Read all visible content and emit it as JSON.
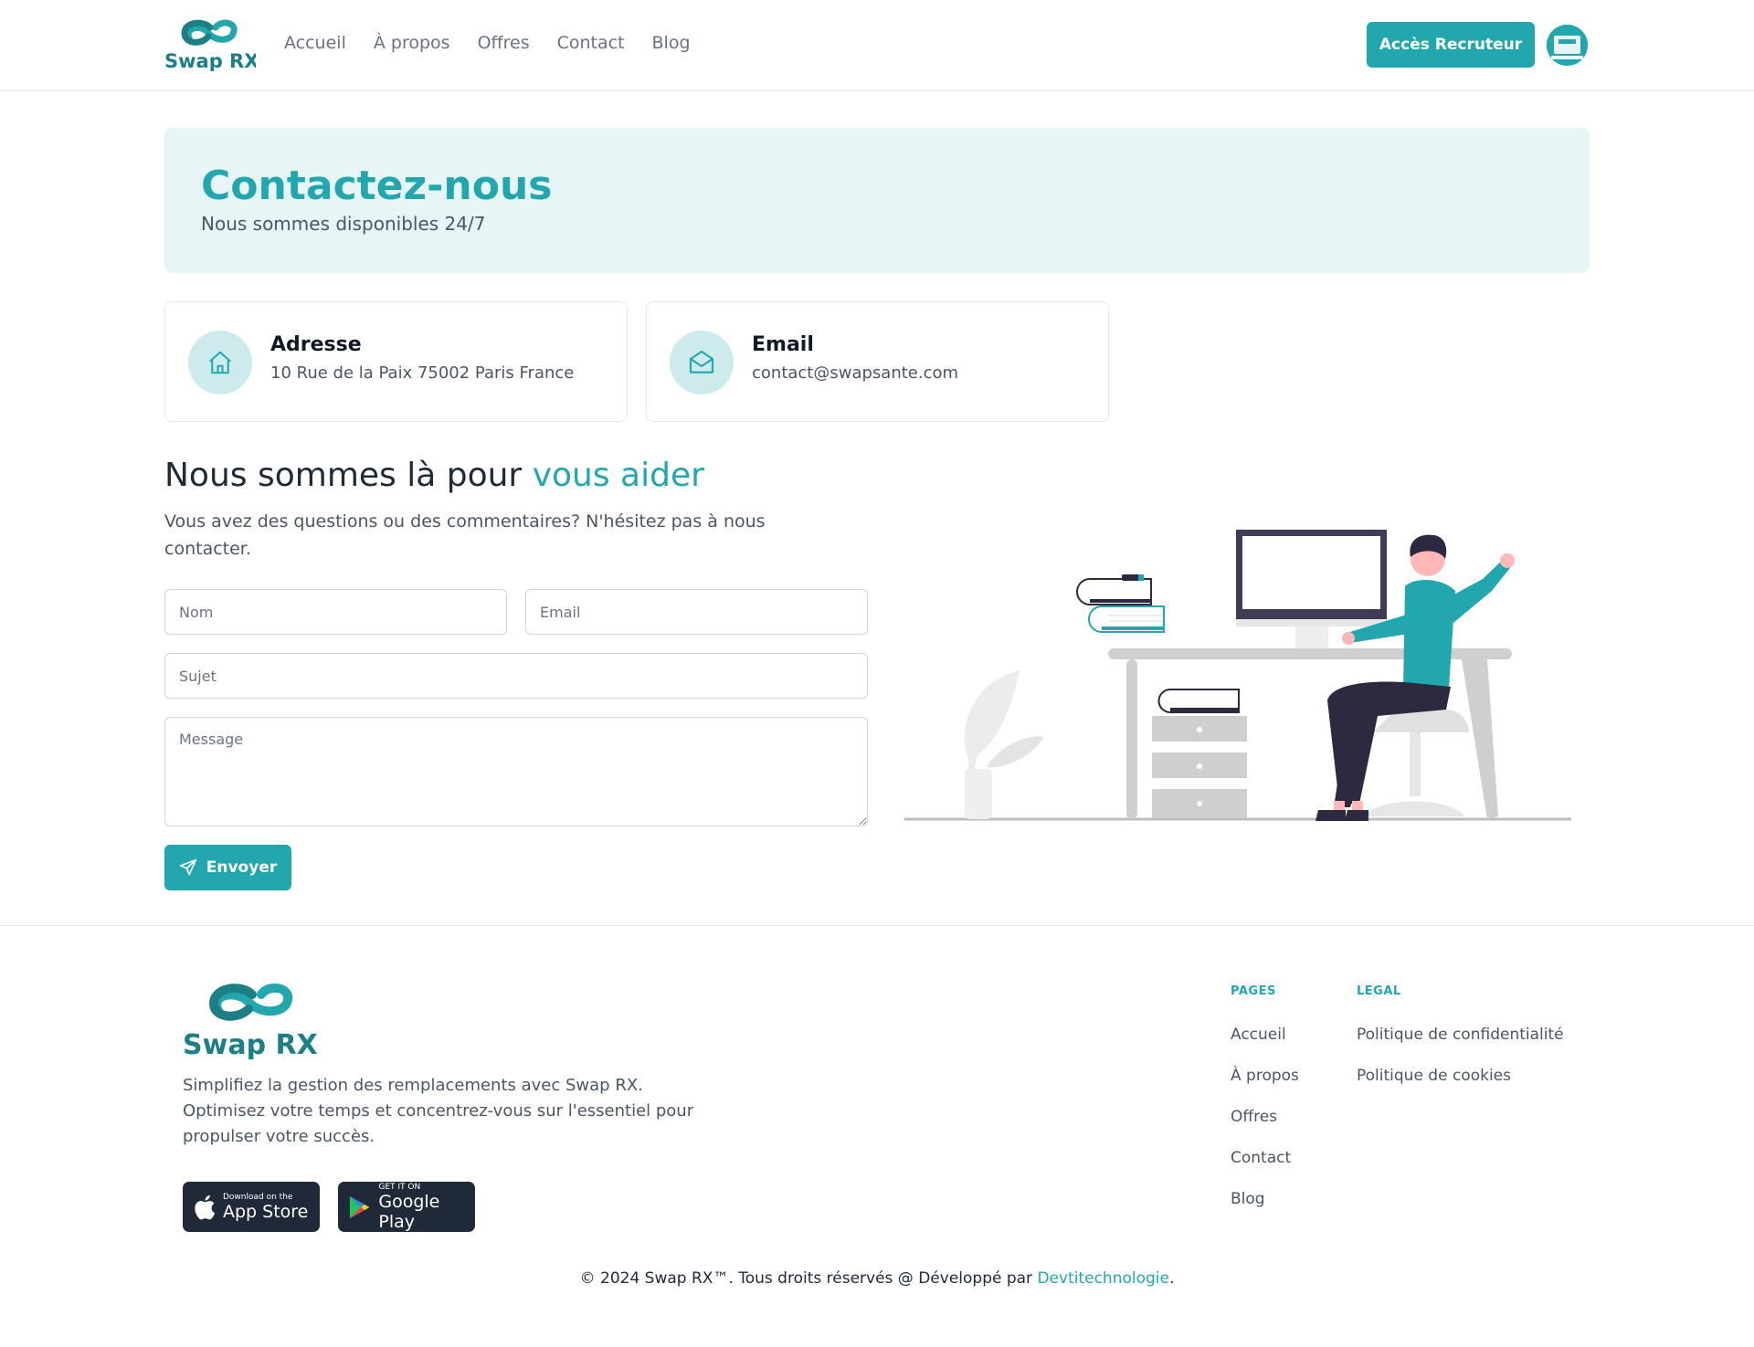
{
  "brand": {
    "name": "Swap RX",
    "accent_color": "#22a7ae",
    "dark_color": "#2c2a3e"
  },
  "nav": {
    "links": [
      "Accueil",
      "À propos",
      "Offres",
      "Contact",
      "Blog"
    ],
    "recruiter_button": "Accès Recruteur",
    "avatar_icon": "user-avatar-icon"
  },
  "hero": {
    "title": "Contactez-nous",
    "subtitle": "Nous sommes disponibles 24/7"
  },
  "info_cards": [
    {
      "icon": "home-icon",
      "title": "Adresse",
      "value": "10 Rue de la Paix 75002 Paris France"
    },
    {
      "icon": "mail-icon",
      "title": "Email",
      "value": "contact@swapsante.com"
    }
  ],
  "help": {
    "title_part1": "Nous sommes là pour ",
    "title_accent": "vous aider",
    "description": "Vous avez des questions ou des commentaires? N'hésitez pas à nous contacter."
  },
  "form": {
    "name_placeholder": "Nom",
    "email_placeholder": "Email",
    "subject_placeholder": "Sujet",
    "message_placeholder": "Message",
    "submit_label": "Envoyer",
    "submit_icon": "send-icon"
  },
  "footer": {
    "description": "Simplifiez la gestion des remplacements avec Swap RX. Optimisez votre temps et concentrez-vous sur l'essentiel pour propulser votre succès.",
    "app_store": {
      "small": "Download on the",
      "big": "App Store"
    },
    "google_play": {
      "small": "GET IT ON",
      "big": "Google Play"
    },
    "pages_title": "PAGES",
    "pages": [
      "Accueil",
      "À propos",
      "Offres",
      "Contact",
      "Blog"
    ],
    "legal_title": "LEGAL",
    "legal": [
      "Politique de confidentialité",
      "Politique de cookies"
    ],
    "copyright_prefix": "© 2024 Swap RX™. Tous droits réservés @ Développé par ",
    "copyright_link": "Devtitechnologie",
    "copyright_suffix": "."
  }
}
